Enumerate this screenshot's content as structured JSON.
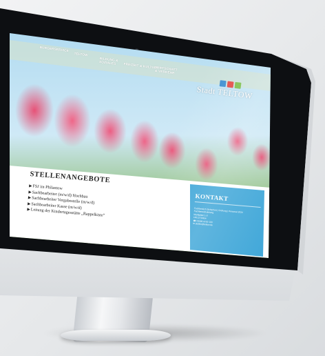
{
  "nav": {
    "items": [
      {
        "label": "BÜRGERSERVICE"
      },
      {
        "label": "TELTOW"
      },
      {
        "label": "BILDUNG & SOZIALES"
      },
      {
        "label": "FREIZEIT & KULTUR"
      },
      {
        "label": "WIRTSCHAFT & VERKEHR"
      }
    ]
  },
  "logo": {
    "text": "Stadt TELTOW",
    "colors": [
      "#3d8fd1",
      "#e24b47",
      "#7cc04b"
    ]
  },
  "content": {
    "title": "STELLENANGEBOTE",
    "jobs": [
      "FSJ im Philantow",
      "Sachbearbeiter (m/w/d) Hochbau",
      "Sachbearbeiter Vergabestelle (m/w/d)",
      "Sachbearbeiter Kasse (m/w/d)",
      "Leitung der Kindertagesstätte „Rappelkiste“"
    ]
  },
  "kontakt": {
    "title": "KONTAKT",
    "lines": [
      "Fachbereich Sicherheit | Ordnung | Personal 2024",
      "Fachbereichsleitung",
      "Marktplatz 1-3",
      "14513 Teltow",
      "☎ 03328 4781-100",
      "✉ stellen@teltow.de"
    ]
  },
  "colors": {
    "accent": "#3ea6d8",
    "bezel": "#0d0f12"
  }
}
